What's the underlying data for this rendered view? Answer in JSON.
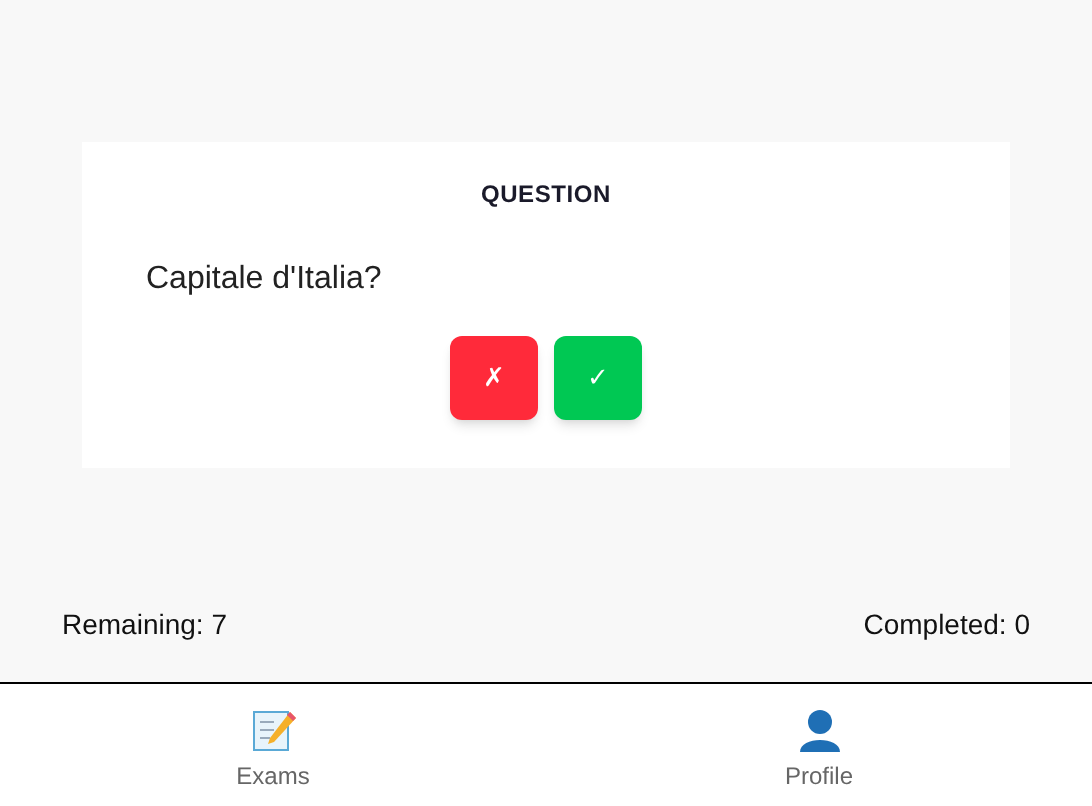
{
  "card": {
    "title": "QUESTION",
    "question": "Capitale d'Italia?",
    "buttons": [
      {
        "kind": "wrong",
        "label": "✗"
      },
      {
        "kind": "right",
        "label": "✓"
      }
    ]
  },
  "status": {
    "remaining": "Remaining: 7",
    "completed": "Completed: 0"
  },
  "tabs": [
    {
      "kind": "exams",
      "label": "Exams"
    },
    {
      "kind": "profile",
      "label": "Profile"
    }
  ]
}
